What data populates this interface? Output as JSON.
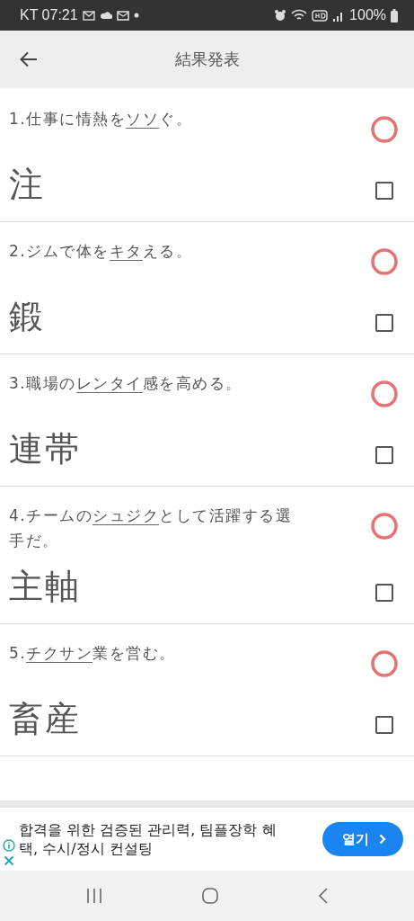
{
  "status_bar": {
    "carrier_time": "KT 07:21",
    "battery": "100%"
  },
  "app_bar": {
    "title": "結果発表"
  },
  "questions": [
    {
      "before": "1.仕事に情熱を",
      "underlined": "ソソ",
      "after": "ぐ。",
      "answer": "注",
      "correct": true,
      "checked": false
    },
    {
      "before": "2.ジムで体を",
      "underlined": "キタ",
      "after": "える。",
      "answer": "鍛",
      "correct": true,
      "checked": false
    },
    {
      "before": "3.職場の",
      "underlined": "レンタイ",
      "after": "感を高める。",
      "answer": "連帯",
      "correct": true,
      "checked": false
    },
    {
      "before": "4.チームの",
      "underlined": "シュジク",
      "after": "として活躍する選手だ。",
      "answer": "主軸",
      "correct": true,
      "checked": false
    },
    {
      "before": "5.",
      "underlined": "チクサン",
      "after": "業を営む。",
      "answer": "畜産",
      "correct": true,
      "checked": false
    }
  ],
  "ad": {
    "text": "합격을 위한 검증된 관리력, 팀플장학 혜택, 수시/정시 컨설팅",
    "button": "열기"
  }
}
